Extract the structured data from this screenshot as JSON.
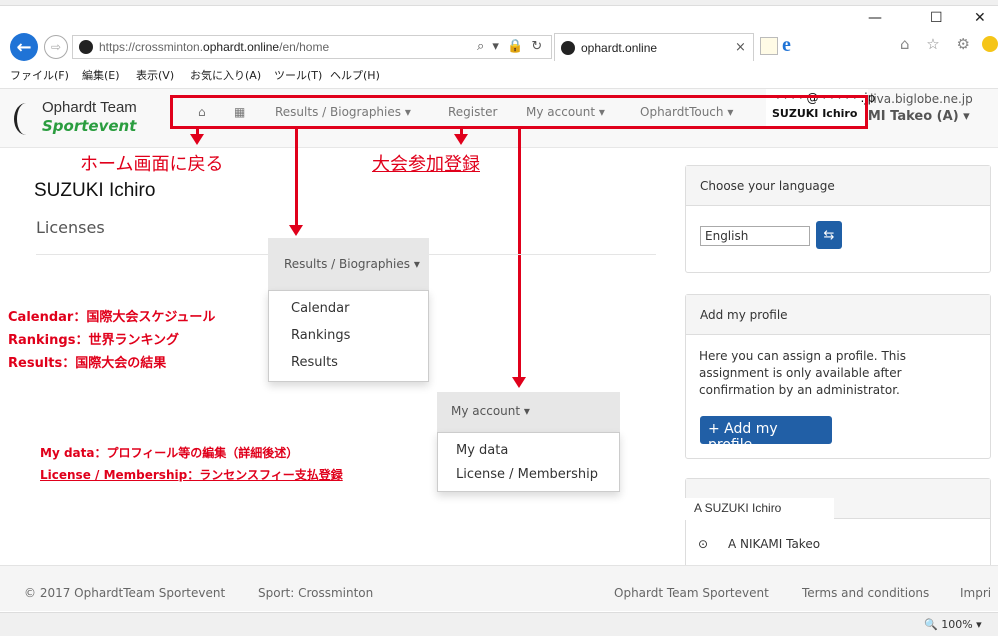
{
  "browser": {
    "url_prefix": "https://crossminton.",
    "url_domain": "ophardt.online",
    "url_suffix": "/en/home",
    "address_tools": "⌕ ▾ 🔒 ↻",
    "tab_title": "ophardt.online",
    "tab_close": "×",
    "ie_logo": "e",
    "window_controls": {
      "minimize": "—",
      "maximize": "☐",
      "close": "✕"
    },
    "right_icons": "⌂ ☆ ⚙",
    "menu": [
      "ファイル(F)",
      "編集(E)",
      "表示(V)",
      "お気に入り(A)",
      "ツール(T)",
      "ヘルプ(H)"
    ],
    "zoom": "🔍 100%  ▾"
  },
  "site": {
    "logo_top": "Ophardt Team",
    "logo_bottom": "Sportevent",
    "nav": {
      "home_icon": "⌂",
      "grid_icon": "▦",
      "results": "Results / Biographies ▾",
      "register": "Register",
      "my_account": "My account ▾",
      "ophardt_touch": "OphardtTouch ▾"
    },
    "email_masked": "· · · · @ · · · · · .jp",
    "user_masked": "SUZUKI Ichiro",
    "email_bg": "iiva.biglobe.ne.jp",
    "user_bg": "NIKAMI Takeo (A) ▾"
  },
  "annotations": {
    "home": "ホーム画面に戻る",
    "register": "大会参加登録",
    "calendar": "Calendar：国際大会スケジュール",
    "rankings": "Rankings：世界ランキング",
    "results": "Results：国際大会の結果",
    "mydata": "My data：プロフィール等の編集（詳細後述）",
    "license": "License / Membership：ランセンスフィー支払登録"
  },
  "main": {
    "owner_name": "SUZUKI Ichiro",
    "licenses_heading": "Licenses"
  },
  "dropdown_results": {
    "header": "Results / Biographies ▾",
    "items": [
      "Calendar",
      "Rankings",
      "Results"
    ]
  },
  "dropdown_account": {
    "header": "My account ▾",
    "items": [
      "My data",
      "License / Membership"
    ]
  },
  "sidebar": {
    "language": {
      "title": "Choose your language",
      "selected": "English",
      "button_icon": "⇆"
    },
    "profile": {
      "title": "Add my profile",
      "text_lines": [
        "Here you can assign a profile. This",
        "assignment is only available after",
        "confirmation by an administrator."
      ],
      "button": "+ Add my profile"
    },
    "profiles": {
      "item1": "A  SUZUKI Ichiro",
      "radio": "⊙",
      "item2": "A  NIKAMI Takeo"
    }
  },
  "footer": {
    "copyright": "© 2017 OphardtTeam Sportevent",
    "sport": "Sport: Crossminton",
    "team": "Ophardt Team Sportevent",
    "terms": "Terms and conditions",
    "imprint": "Impri"
  },
  "colors": {
    "annotation_red": "#e0001b",
    "logo_green": "#2a9d3f",
    "button_blue": "#215fa6"
  }
}
